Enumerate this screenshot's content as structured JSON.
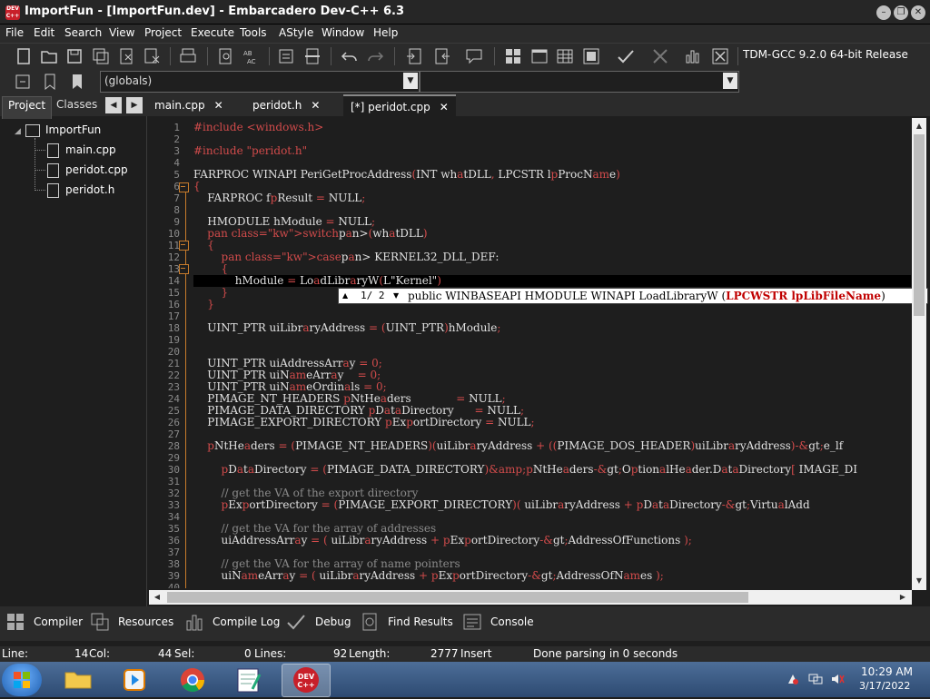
{
  "window": {
    "title": "ImportFun - [ImportFun.dev] - Embarcadero Dev-C++ 6.3",
    "logo_text": "DEV C++"
  },
  "menu": [
    "File",
    "Edit",
    "Search",
    "View",
    "Project",
    "Execute",
    "Tools",
    "AStyle",
    "Window",
    "Help"
  ],
  "toolbar": {
    "compiler": "TDM-GCC 9.2.0 64-bit Release",
    "scope": "(globals)"
  },
  "left_panel": {
    "tabs": [
      "Project",
      "Classes"
    ],
    "tree": {
      "root": "ImportFun",
      "files": [
        "main.cpp",
        "peridot.cpp",
        "peridot.h"
      ]
    }
  },
  "editor": {
    "tabs": [
      "main.cpp",
      "peridot.h",
      "[*] peridot.cpp"
    ],
    "close_glyph": "✕",
    "line_numbers": [
      "1",
      "2",
      "3",
      "4",
      "5",
      "6",
      "7",
      "8",
      "9",
      "10",
      "11",
      "12",
      "13",
      "14",
      "15",
      "16",
      "17",
      "18",
      "19",
      "20",
      "21",
      "22",
      "23",
      "24",
      "25",
      "26",
      "27",
      "28",
      "29",
      "30",
      "31",
      "32",
      "33",
      "34",
      "35",
      "36",
      "37",
      "38",
      "39",
      "40"
    ],
    "lines": [
      "#include <windows.h>",
      "",
      "#include \"peridot.h\"",
      "",
      "FARPROC WINAPI PeriGetProcAddress(INT whatDLL, LPCSTR lpProcName)",
      "{",
      "    FARPROC fpResult = NULL;",
      "",
      "    HMODULE hModule = NULL;",
      "    switch(whatDLL)",
      "    {",
      "        case KERNEL32_DLL_DEF:",
      "        {",
      "            hModule = LoadLibraryW(L\"Kernel\")",
      "        }",
      "    }",
      "",
      "    UINT_PTR uiLibraryAddress = (UINT_PTR)hModule;",
      "",
      "",
      "    UINT_PTR uiAddressArray = 0;",
      "    UINT_PTR uiNameArray    = 0;",
      "    UINT_PTR uiNameOrdinals = 0;",
      "    PIMAGE_NT_HEADERS pNtHeaders             = NULL;",
      "    PIMAGE_DATA_DIRECTORY pDataDirectory      = NULL;",
      "    PIMAGE_EXPORT_DIRECTORY pExportDirectory = NULL;",
      "",
      "    pNtHeaders = (PIMAGE_NT_HEADERS)(uiLibraryAddress + ((PIMAGE_DOS_HEADER)uiLibraryAddress)->e_lf",
      "",
      "        pDataDirectory = (PIMAGE_DATA_DIRECTORY)&pNtHeaders->OptionalHeader.DataDirectory[ IMAGE_DI",
      "",
      "        // get the VA of the export directory",
      "        pExportDirectory = (PIMAGE_EXPORT_DIRECTORY)( uiLibraryAddress + pDataDirectory->VirtualAdd",
      "",
      "        // get the VA for the array of addresses",
      "        uiAddressArray = ( uiLibraryAddress + pExportDirectory->AddressOfFunctions );",
      "",
      "        // get the VA for the array of name pointers",
      "        uiNameArray = ( uiLibraryAddress + pExportDirectory->AddressOfNames );",
      ""
    ],
    "hint": {
      "counter": "1/ 2",
      "prefix": "public WINBASEAPI HMODULE WINAPI LoadLibraryW (",
      "param": "LPCWSTR lpLibFileName",
      "suffix": ")"
    }
  },
  "bottom_tabs": [
    "Compiler",
    "Resources",
    "Compile Log",
    "Debug",
    "Find Results",
    "Console"
  ],
  "status": {
    "line_label": "Line:",
    "line_value": "14",
    "col_label": "Col:",
    "col_value": "44",
    "sel_label": "Sel:",
    "sel_value": "0",
    "lines_label": "Lines:",
    "lines_value": "92",
    "length_label": "Length:",
    "length_value": "2777",
    "mode": "Insert",
    "message": "Done parsing in 0 seconds"
  },
  "taskbar": {
    "time": "10:29 AM",
    "date": "3/17/2022"
  }
}
